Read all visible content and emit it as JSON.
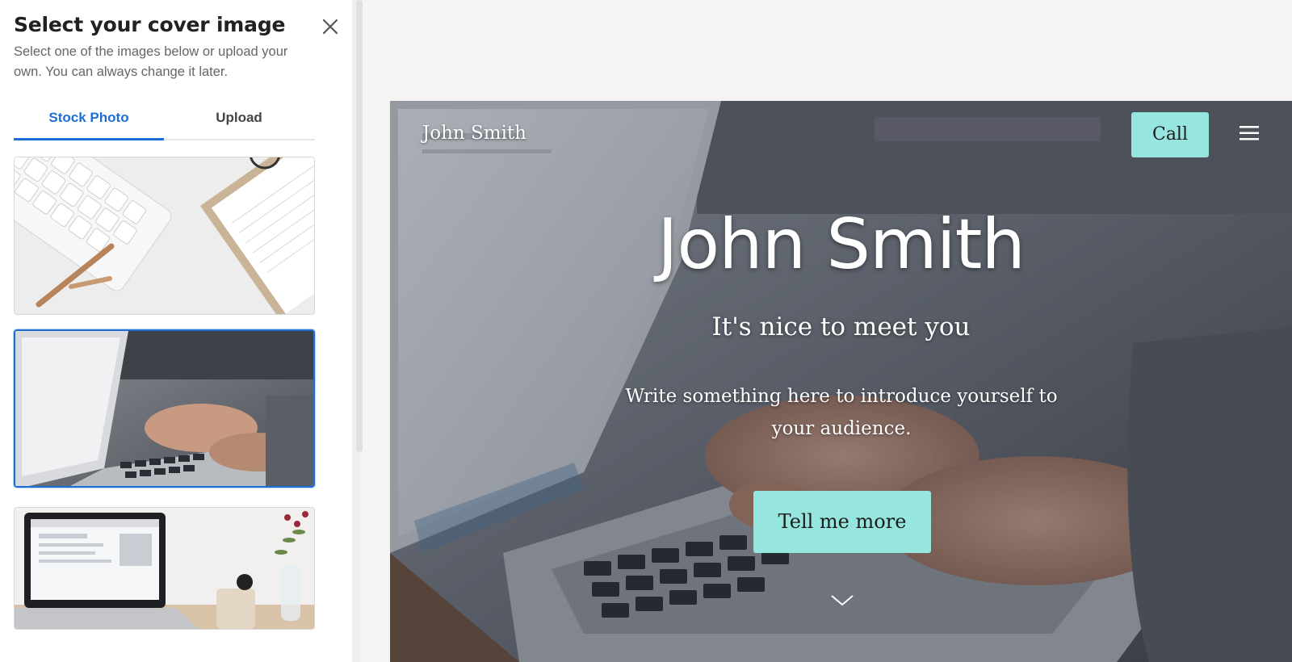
{
  "panel": {
    "title": "Select your cover image",
    "description": "Select one of the images below or upload your own. You can always change it later.",
    "tabs": [
      {
        "label": "Stock Photo",
        "active": true
      },
      {
        "label": "Upload",
        "active": false
      }
    ],
    "images": [
      {
        "name": "keyboard-notebook-pen",
        "selected": false
      },
      {
        "name": "hands-typing-laptop",
        "selected": true
      },
      {
        "name": "laptop-coffee-flowers",
        "selected": false
      }
    ],
    "accent_color": "#1e6ed6"
  },
  "preview": {
    "brand": "John Smith",
    "call_label": "Call",
    "hero_title": "John Smith",
    "hero_subtitle": "It's nice to meet you",
    "hero_body": "Write something here to introduce yourself to your audience.",
    "cta_label": "Tell me more",
    "button_color": "#96e6df"
  }
}
